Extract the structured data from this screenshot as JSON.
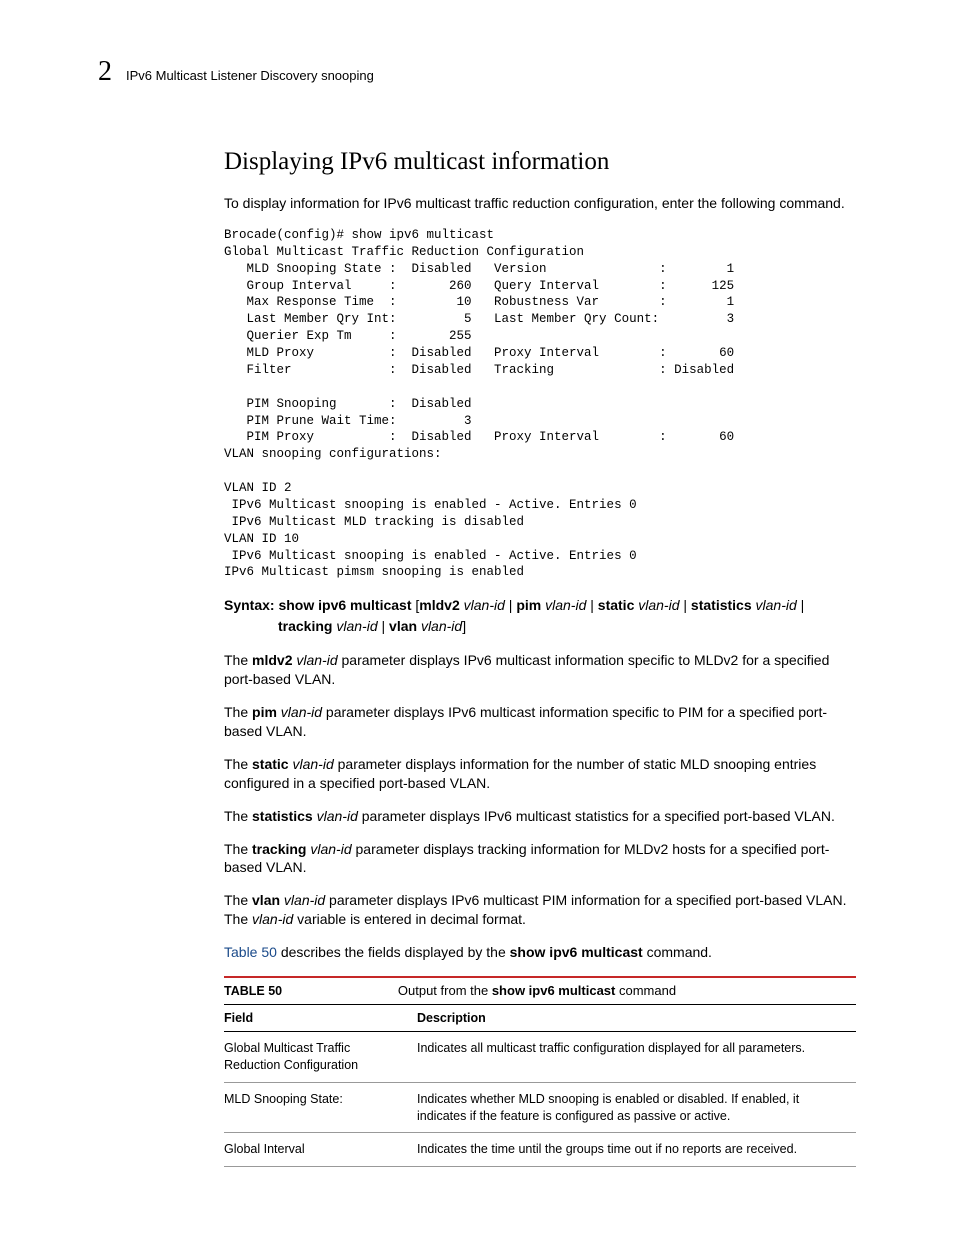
{
  "header": {
    "chapter_number": "2",
    "chapter_title": "IPv6 Multicast Listener Discovery snooping"
  },
  "section": {
    "title": "Displaying IPv6 multicast information",
    "intro": "To display information for IPv6 multicast traffic reduction configuration, enter the following command."
  },
  "cli_output": "Brocade(config)# show ipv6 multicast\nGlobal Multicast Traffic Reduction Configuration\n   MLD Snooping State :  Disabled   Version               :        1\n   Group Interval     :       260   Query Interval        :      125\n   Max Response Time  :        10   Robustness Var        :        1\n   Last Member Qry Int:         5   Last Member Qry Count:         3\n   Querier Exp Tm     :       255\n   MLD Proxy          :  Disabled   Proxy Interval        :       60\n   Filter             :  Disabled   Tracking              : Disabled\n\n   PIM Snooping       :  Disabled\n   PIM Prune Wait Time:         3\n   PIM Proxy          :  Disabled   Proxy Interval        :       60\nVLAN snooping configurations:\n\nVLAN ID 2\n IPv6 Multicast snooping is enabled - Active. Entries 0\n IPv6 Multicast MLD tracking is disabled\nVLAN ID 10\n IPv6 Multicast snooping is enabled - Active. Entries 0\nIPv6 Multicast pimsm snooping is enabled",
  "syntax": {
    "label": "Syntax:",
    "cmd": "show ipv6 multicast",
    "opt_mldv2": "mldv2",
    "opt_pim": "pim",
    "opt_static": "static",
    "opt_statistics": "statistics",
    "opt_tracking": "tracking",
    "opt_vlan": "vlan",
    "arg_vlanid": "vlan-id"
  },
  "paras": {
    "mldv2": {
      "pre": "The ",
      "kw": "mldv2",
      "arg": " vlan-id",
      "post": " parameter displays IPv6 multicast information specific to MLDv2 for a specified port-based VLAN."
    },
    "pim": {
      "pre": "The ",
      "kw": "pim",
      "arg": " vlan-id",
      "post": " parameter displays IPv6 multicast information specific to PIM for a specified port-based VLAN."
    },
    "static": {
      "pre": "The ",
      "kw": "static",
      "arg": " vlan-id",
      "post": " parameter displays information for the number of static MLD snooping entries configured in a specified port-based VLAN."
    },
    "statistics": {
      "pre": "The ",
      "kw": "statistics",
      "arg": " vlan-id",
      "post": " parameter displays IPv6 multicast statistics for a specified port-based VLAN."
    },
    "tracking": {
      "pre": "The ",
      "kw": "tracking",
      "arg": " vlan-id",
      "post": " parameter displays tracking information for MLDv2 hosts for a specified port-based VLAN."
    },
    "vlan": {
      "pre": "The ",
      "kw": "vlan",
      "arg": " vlan-id",
      "post1": " parameter displays IPv6 multicast PIM information for a specified port-based VLAN. The ",
      "arg2": "vlan-id",
      "post2": " variable is entered in decimal format."
    }
  },
  "tableref": {
    "link": "Table 50",
    "pre": " describes the fields displayed by the ",
    "cmd": "show ipv6 multicast",
    "post": " command."
  },
  "table": {
    "label": "TABLE 50",
    "caption_pre": "Output from the ",
    "caption_cmd": "show ipv6 multicast",
    "caption_post": " command",
    "head_field": "Field",
    "head_desc": "Description",
    "rows": [
      {
        "field": "Global Multicast Traffic Reduction Configuration",
        "desc": "Indicates all multicast traffic configuration displayed for all parameters."
      },
      {
        "field": "MLD Snooping State:",
        "desc": "Indicates whether MLD snooping is enabled or disabled. If enabled, it indicates if the feature is configured as passive or active."
      },
      {
        "field": "Global Interval",
        "desc": "Indicates the time until the groups time out if no reports are received."
      }
    ]
  }
}
